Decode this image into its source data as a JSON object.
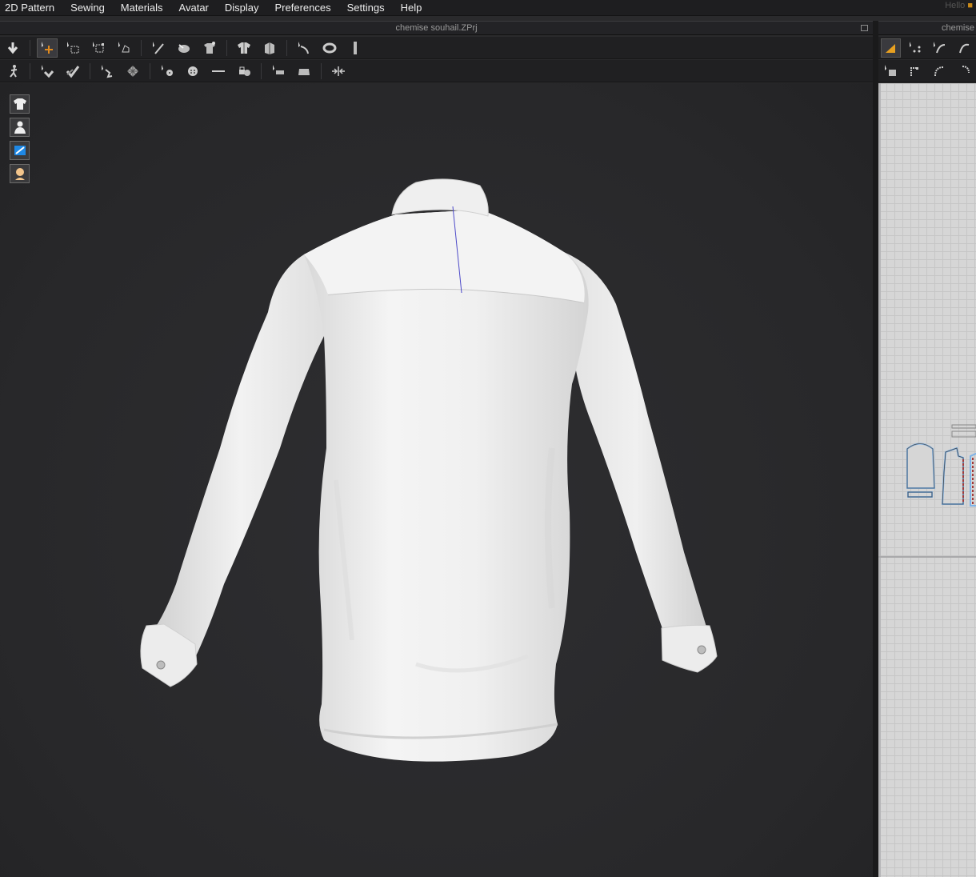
{
  "menu": {
    "items": [
      "2D Pattern",
      "Sewing",
      "Materials",
      "Avatar",
      "Display",
      "Preferences",
      "Settings",
      "Help"
    ],
    "greeting": "Hello"
  },
  "windows": {
    "view3d_title": "chemise souhail.ZPrj",
    "view2d_title": "chemise"
  },
  "toolbar3d_row1": [
    "simulation-icon",
    "select-move-icon",
    "select-mesh-box-icon",
    "transform-pattern-icon",
    "flatten-icon",
    "pin-icon",
    "tack-icon",
    "fold-arrangement-icon",
    "show-garment-icon",
    "arrangement-icon",
    "strap-icon",
    "belt-icon",
    "ruler-icon"
  ],
  "toolbar3d_row2": [
    "fitting-icon",
    "steam-icon",
    "iron-icon",
    "measure-icon",
    "fabric-grid-icon",
    "add-button-icon",
    "button-icon",
    "buttonhole-icon",
    "button-lock-icon",
    "fold-icon",
    "fold-flat-icon",
    "shrink-icon"
  ],
  "side_panel": [
    "show-garment-icon",
    "show-avatar-icon",
    "show-3d-pen-icon",
    "show-skin-icon"
  ],
  "colors": {
    "background": "#2a2a2c",
    "accent": "#e08a1e",
    "pattern_outline": "#7fb3e8",
    "stitch": "#a33b3b"
  }
}
